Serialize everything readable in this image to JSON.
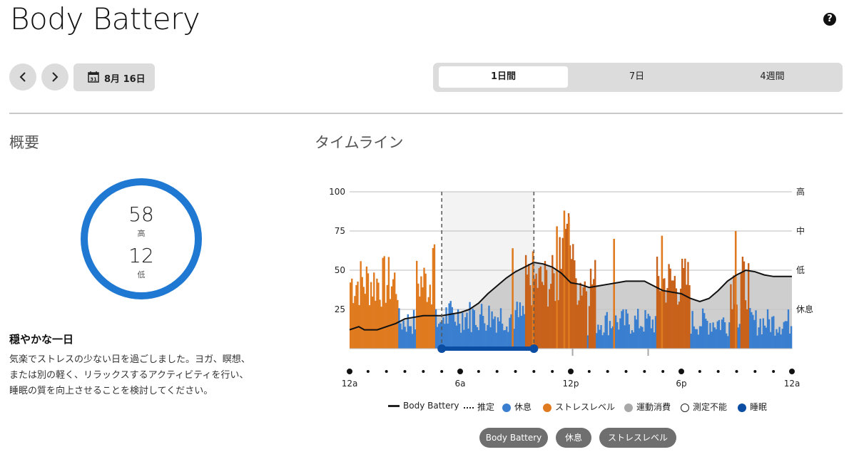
{
  "page_title": "Body Battery",
  "help_label": "?",
  "date_label": "8月 16日",
  "calendar_day": "31",
  "range_tabs": [
    {
      "label": "1日間",
      "active": true
    },
    {
      "label": "7日",
      "active": false
    },
    {
      "label": "4週間",
      "active": false
    }
  ],
  "summary": {
    "title": "概要",
    "high_value": "58",
    "high_label": "高",
    "low_value": "12",
    "low_label": "低",
    "headline": "穏やかな一日",
    "description_lines": [
      "気楽でストレスの少ない日を過ごしました。ヨガ、瞑想、",
      "または別の軽く、リラックスするアクティビティを行い、",
      "睡眠の質を向上させることを検討してください。"
    ]
  },
  "timeline": {
    "title": "タイムライン"
  },
  "colors": {
    "rest": "#3a7fcf",
    "stress": "#e07a1f",
    "stress_dark": "#c8621a",
    "activity": "#a8a8a8",
    "sleep": "#0a4da3",
    "ring": "#1f78d1"
  },
  "chart_data": {
    "type": "bar",
    "y_ticks": [
      "100",
      "75",
      "50",
      "25"
    ],
    "right_labels": [
      "高",
      "中",
      "低",
      "休息"
    ],
    "x_labels": [
      "12a",
      "6a",
      "12p",
      "6p",
      "12a"
    ],
    "ylim": [
      0,
      100
    ],
    "sleep_window_hours": [
      5,
      10
    ],
    "body_battery": [
      [
        0,
        12
      ],
      [
        0.5,
        14
      ],
      [
        0.8,
        12
      ],
      [
        1.5,
        12
      ],
      [
        2,
        14
      ],
      [
        2.5,
        16
      ],
      [
        3,
        19
      ],
      [
        3.5,
        20
      ],
      [
        4,
        21
      ],
      [
        5,
        21
      ],
      [
        5.5,
        22
      ],
      [
        6,
        23
      ],
      [
        6.5,
        25
      ],
      [
        7,
        29
      ],
      [
        7.5,
        35
      ],
      [
        8,
        40
      ],
      [
        8.5,
        45
      ],
      [
        9,
        49
      ],
      [
        10,
        55
      ],
      [
        10.5,
        54
      ],
      [
        11,
        52
      ],
      [
        11.5,
        48
      ],
      [
        12,
        42
      ],
      [
        12.5,
        41
      ],
      [
        13,
        39
      ],
      [
        13.5,
        40
      ],
      [
        14,
        41
      ],
      [
        14.5,
        42
      ],
      [
        15,
        43
      ],
      [
        16,
        43
      ],
      [
        16.5,
        40
      ],
      [
        17,
        37
      ],
      [
        18,
        35
      ],
      [
        18.5,
        32
      ],
      [
        19,
        30
      ],
      [
        19.5,
        32
      ],
      [
        20,
        37
      ],
      [
        20.5,
        43
      ],
      [
        21,
        47
      ],
      [
        21.5,
        50
      ],
      [
        22,
        49
      ],
      [
        22.5,
        47
      ],
      [
        23,
        46
      ],
      [
        24,
        46
      ]
    ],
    "legend": [
      {
        "label": "Body Battery",
        "kind": "line"
      },
      {
        "label": "推定",
        "kind": "dotted"
      },
      {
        "label": "休息",
        "kind": "rest"
      },
      {
        "label": "ストレスレベル",
        "kind": "stress"
      },
      {
        "label": "運動消費",
        "kind": "activity"
      },
      {
        "label": "測定不能",
        "kind": "unmeasurable"
      },
      {
        "label": "睡眠",
        "kind": "sleep"
      }
    ]
  },
  "filter_pills": [
    "Body Battery",
    "休息",
    "ストレスレベル"
  ]
}
